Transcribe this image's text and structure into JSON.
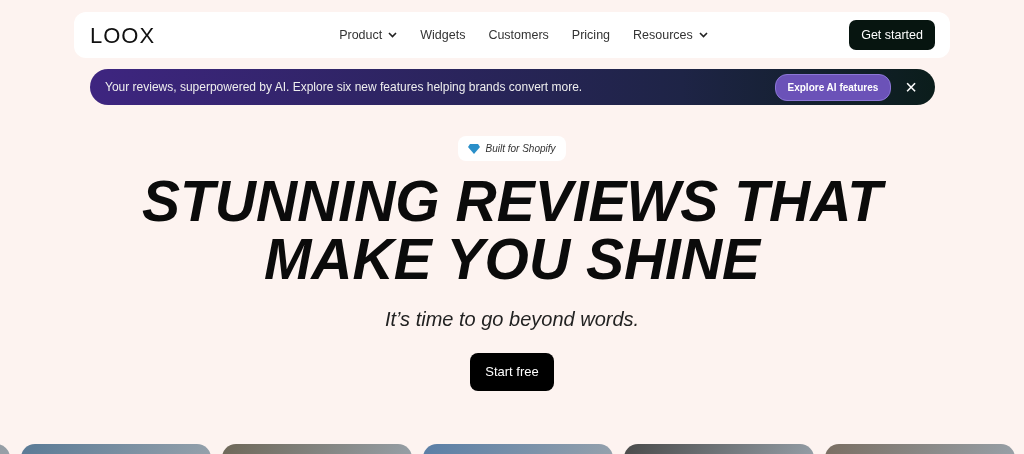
{
  "logo": "LOOX",
  "nav": [
    {
      "label": "Product",
      "dropdown": true
    },
    {
      "label": "Widgets",
      "dropdown": false
    },
    {
      "label": "Customers",
      "dropdown": false
    },
    {
      "label": "Pricing",
      "dropdown": false
    },
    {
      "label": "Resources",
      "dropdown": true
    }
  ],
  "cta": "Get started",
  "banner": {
    "text": "Your reviews, superpowered by AI. Explore six new features helping brands convert more.",
    "button": "Explore AI features",
    "close": "×"
  },
  "badge": "Built for Shopify",
  "headline": [
    "STUNNING REVIEWS THAT",
    "MAKE YOU SHINE"
  ],
  "subtitle": "It’s time to go beyond words.",
  "start": "Start free"
}
